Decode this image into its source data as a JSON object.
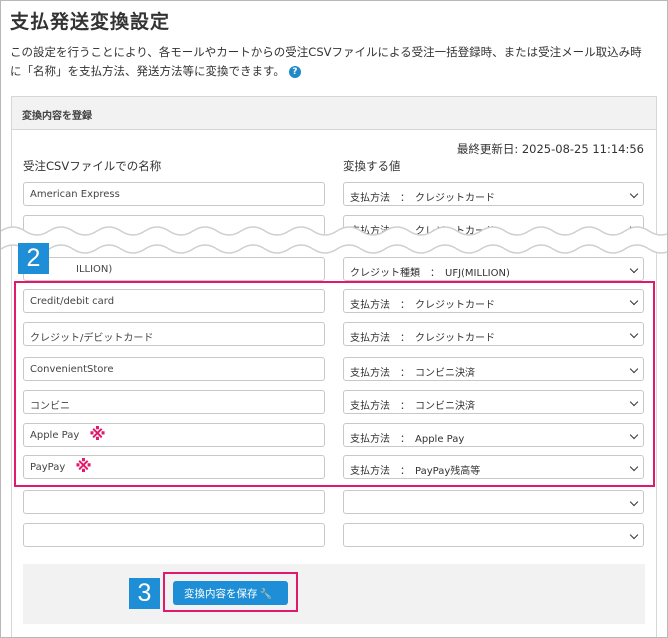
{
  "page": {
    "title": "支払発送変換設定",
    "description_line1": "この設定を行うことにより、各モールやカートからの受注CSVファイルによる受注一括登録時、または受注メール取込み時",
    "description_line2": "に「名称」を支払方法、発送方法等に変換できます。",
    "help_icon_glyph": "?"
  },
  "panel": {
    "header": "変換内容を登録",
    "last_updated": "最終更新日: 2025-08-25 11:14:56",
    "col_left": "受注CSVファイルでの名称",
    "col_right": "変換する値"
  },
  "rows_top": [
    {
      "name": "American Express",
      "value": "支払方法　：　クレジットカード"
    },
    {
      "name": "",
      "value": "支払方法　：　クレジットカード"
    }
  ],
  "row_partial": {
    "name": "ILLION)",
    "value": "クレジット種類　：　UFJ(MILLION)"
  },
  "rows": [
    {
      "name": "Credit/debit card",
      "value": "支払方法　：　クレジットカード",
      "mark": ""
    },
    {
      "name": "クレジット/デビットカード",
      "value": "支払方法　：　クレジットカード",
      "mark": ""
    },
    {
      "name": "ConvenientStore",
      "value": "支払方法　：　コンビニ決済",
      "mark": ""
    },
    {
      "name": "コンビニ",
      "value": "支払方法　：　コンビニ決済",
      "mark": ""
    },
    {
      "name": "Apple Pay",
      "value": "支払方法　：　Apple Pay",
      "mark": "※"
    },
    {
      "name": "PayPay",
      "value": "支払方法　：　PayPay残高等",
      "mark": "※"
    }
  ],
  "rows_empty": [
    {
      "name": "",
      "value": ""
    },
    {
      "name": "",
      "value": ""
    }
  ],
  "badges": {
    "step2": "2",
    "step3": "3"
  },
  "save_button": {
    "label": "変換内容を保存",
    "icon_glyph": "🔧"
  },
  "colors": {
    "accent_blue": "#1e8fd6",
    "highlight_pink": "#e0196c"
  }
}
